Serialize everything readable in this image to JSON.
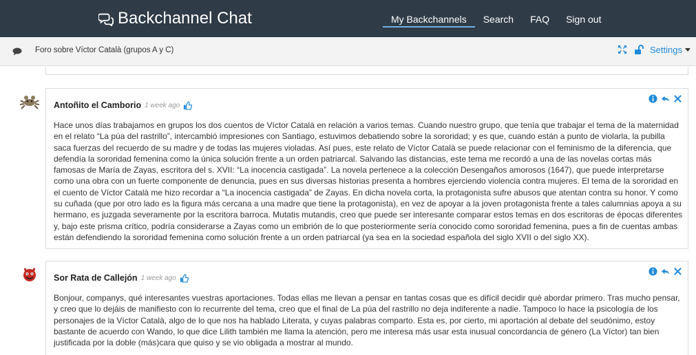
{
  "navbar": {
    "brand": "Backchannel Chat",
    "links": [
      "My Backchannels",
      "Search",
      "FAQ",
      "Sign out"
    ]
  },
  "subbar": {
    "title": "Foro sobre Víctor Català (grupos A y C)",
    "settings_label": "Settings"
  },
  "posts": [
    {
      "author": "Antoñito el Camborio",
      "ago": "1 week ago",
      "body": "Hace unos días trabajamos en grupos los dos cuentos de Víctor Català en relación a varios temas. Cuando nuestro grupo, que tenía que trabajar el tema de la maternidad en el relato “La púa del rastrillo”, intercambió impresiones con Santiago, estuvimos debatiendo sobre la sororidad; y es que, cuando están a punto de violarla, la pubilla saca fuerzas del recuerdo de su madre y de todas las mujeres violadas. Así pues, este relato de Víctor Català se puede relacionar con el feminismo de la diferencia, que defendía la sororidad femenina como la única solución frente a un orden patriarcal. Salvando las distancias, este tema me recordó a una de las novelas cortas más famosas de María de Zayas, escritora del s. XVII: “La inocencia castigada”. La novela pertenece a la colección Desengaños amorosos (1647), que puede interpretarse como una obra con un fuerte componente de denuncia, pues en sus diversas historias presenta a hombres ejerciendo violencia contra mujeres. El tema de la sororidad en el cuento de Víctor Català me hizo recordar a “La inocencia castigada” de Zayas. En dicha novela corta, la protagonista sufre abusos que atentan contra su honor. Y como su cuñada (que por otro lado es la figura más cercana a una madre que tiene la protagonista), en vez de apoyar a la joven protagonista frente a tales calumnias apoya a su hermano, es juzgada severamente por la escritora barroca. Mutatis mutandis, creo que puede ser interesante comparar estos temas en dos escritoras de épocas diferentes y, bajo este prisma crítico, podría considerarse a Zayas como un embrión de lo que posteriormente sería conocido como sororidad femenina, pues a fin de cuentas ambas están defendiendo la sororidad femenina como solución frente a un orden patriarcal (ya sea en la sociedad española del siglo XVII o del siglo XX)."
    },
    {
      "author": "Sor Rata de Callejón",
      "ago": "1 week ago",
      "body": "Bonjour, companys, qué interesantes vuestras aportaciones. Todas ellas me llevan a pensar en tantas cosas que es difícil decidir qué abordar primero. Tras mucho pensar, y creo que lo dejáis de manifiesto con lo recurrente del tema, creo que el final de La púa del rastrillo no deja indiferente a nadie. Tampoco lo hace la psicología de los personajes de la Víctor Català, algo de lo que nos ha hablado Literata, y cuyas palabras comparto. Esta es, por cierto, mi aportación al debate del seudónimo, estoy bastante de acuerdo con Wando, lo que dice Lilith también me llama la atención, pero me interesa más usar esta inusual concordancia de género (La Víctor) tan bien justificada por la doble (más)cara que quiso y se vio obligada a mostrar al mundo."
    }
  ],
  "colors": {
    "navbar_bg": "#2f3b47",
    "link_blue": "#1f8ad9"
  },
  "icons": [
    "chat-bubbles-icon",
    "chat-icon",
    "expand-icon",
    "unlock-icon",
    "thumbs-up-icon",
    "info-icon",
    "reply-icon",
    "close-icon"
  ]
}
